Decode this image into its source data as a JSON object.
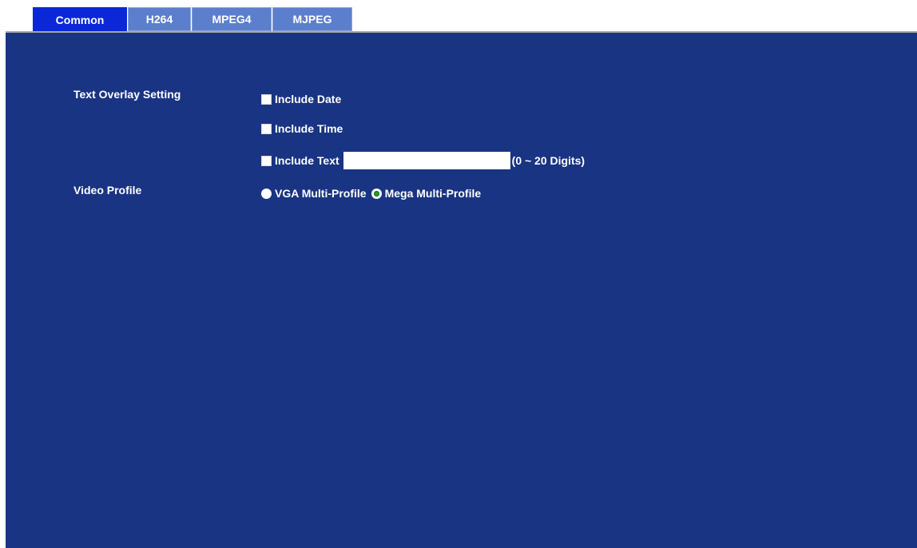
{
  "tabs": [
    {
      "label": "Common",
      "active": true
    },
    {
      "label": "H264",
      "active": false
    },
    {
      "label": "MPEG4",
      "active": false
    },
    {
      "label": "MJPEG",
      "active": false
    }
  ],
  "text_overlay": {
    "section_label": "Text Overlay Setting",
    "include_date": {
      "label": "Include Date",
      "checked": false
    },
    "include_time": {
      "label": "Include Time",
      "checked": false
    },
    "include_text": {
      "label": "Include Text",
      "checked": false,
      "value": "",
      "hint": "(0 ~ 20 Digits)"
    }
  },
  "video_profile": {
    "section_label": "Video Profile",
    "options": [
      {
        "label": "VGA Multi-Profile",
        "selected": false
      },
      {
        "label": "Mega Multi-Profile",
        "selected": true
      }
    ]
  },
  "colors": {
    "panel_background": "#193482",
    "active_tab": "#0a28d8",
    "inactive_tab": "#5b7fcc",
    "radio_selected": "#2a9a2a"
  }
}
